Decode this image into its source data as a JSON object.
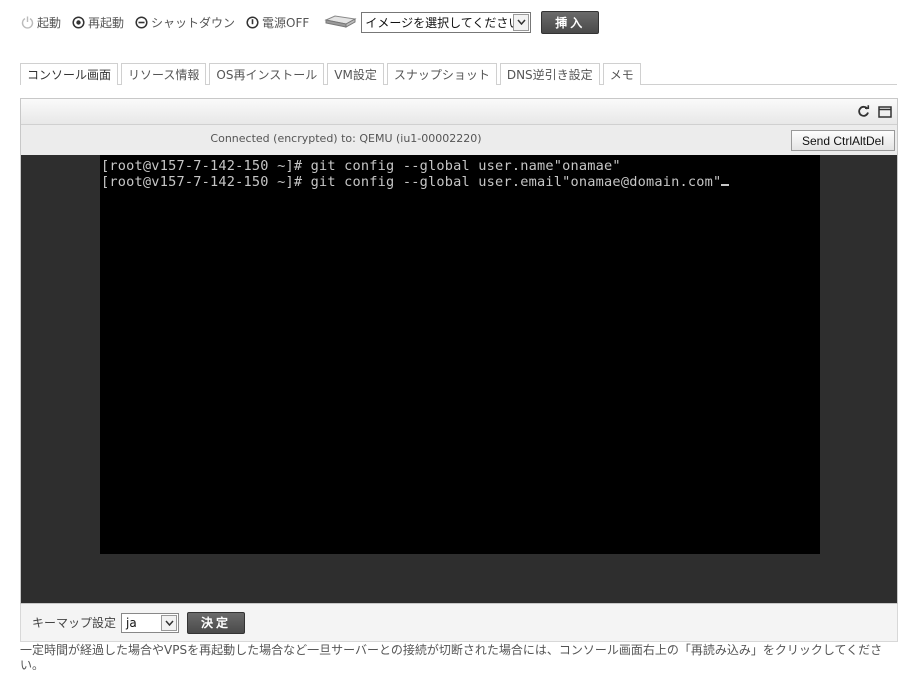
{
  "power": {
    "start_label": "起動",
    "restart_label": "再起動",
    "shutdown_label": "シャットダウン",
    "poweroff_label": "電源OFF"
  },
  "iso": {
    "selected": "イメージを選択してください",
    "insert_label": "挿入"
  },
  "tabs": [
    {
      "label": "コンソール画面",
      "active": true
    },
    {
      "label": "リソース情報"
    },
    {
      "label": "OS再インストール"
    },
    {
      "label": "VM設定"
    },
    {
      "label": "スナップショット"
    },
    {
      "label": "DNS逆引き設定"
    },
    {
      "label": "メモ"
    }
  ],
  "console": {
    "status": "Connected (encrypted) to: QEMU (iu1-00002220)",
    "cad_label": "Send CtrlAltDel",
    "lines": [
      "[root@v157-7-142-150 ~]# git config --global user.name\"onamae\"",
      "[root@v157-7-142-150 ~]# git config --global user.email\"onamae@domain.com\""
    ]
  },
  "keymap": {
    "label": "キーマップ設定",
    "selected": "ja",
    "apply_label": "決定"
  },
  "note": "一定時間が経過した場合やVPSを再起動した場合など一旦サーバーとの接続が切断された場合には、コンソール画面右上の「再読み込み」をクリックしてください。",
  "colors": {
    "button_dark": "#555555",
    "console_bg": "#2e2e2e",
    "screen_bg": "#000000",
    "terminal_text": "#c6c6c6"
  }
}
